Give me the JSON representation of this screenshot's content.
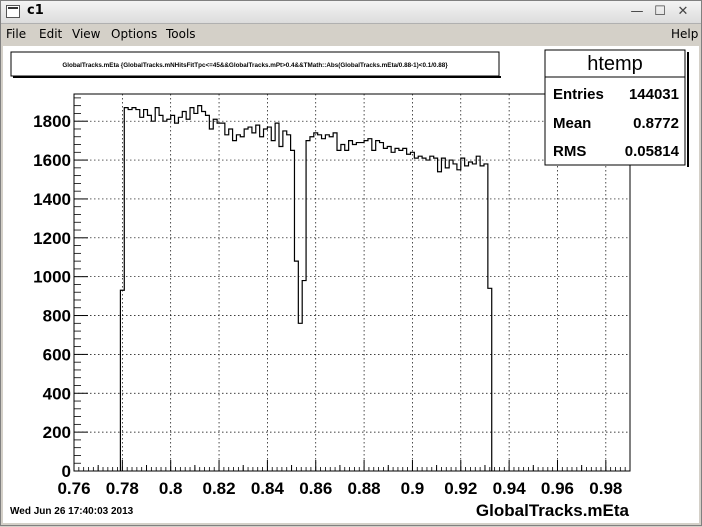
{
  "window": {
    "title": "c1"
  },
  "titlebar_buttons": {
    "minimize": "—",
    "maximize": "☐",
    "close": "✕"
  },
  "menu": {
    "file": "File",
    "edit": "Edit",
    "view": "View",
    "options": "Options",
    "tools": "Tools",
    "help": "Help"
  },
  "canvas": {
    "title_box": "GlobalTracks.mEta {GlobalTracks.mNHitsFitTpc<=45&&GlobalTracks.mPt>0.4&&TMath::Abs(GlobalTracks.mEta/0.88-1)<0.1/0.88}",
    "timestamp": "Wed Jun 26 17:40:03 2013",
    "stats": {
      "name": "htemp",
      "entries_label": "Entries",
      "entries_value": "144031",
      "mean_label": "Mean",
      "mean_value": "0.8772",
      "rms_label": "RMS",
      "rms_value": "0.05814"
    }
  },
  "chart_data": {
    "type": "histogram",
    "xlabel": "GlobalTracks.mEta",
    "xlim": [
      0.76,
      0.99
    ],
    "ylim": [
      0,
      1940
    ],
    "xticks": [
      0.76,
      0.78,
      0.8,
      0.82,
      0.84,
      0.86,
      0.88,
      0.9,
      0.92,
      0.94,
      0.96,
      0.98
    ],
    "xtick_labels": [
      "0.76",
      "0.78",
      "0.8",
      "0.82",
      "0.84",
      "0.86",
      "0.88",
      "0.9",
      "0.92",
      "0.94",
      "0.96",
      "0.98"
    ],
    "yticks": [
      0,
      200,
      400,
      600,
      800,
      1000,
      1200,
      1400,
      1600,
      1800
    ],
    "ytick_labels": [
      "0",
      "200",
      "400",
      "600",
      "800",
      "1000",
      "1200",
      "1400",
      "1600",
      "1800"
    ],
    "grid": true,
    "bin_low": 0.7792,
    "bin_width": 0.0016,
    "values": [
      930,
      1870,
      1860,
      1870,
      1860,
      1820,
      1860,
      1830,
      1800,
      1870,
      1830,
      1800,
      1810,
      1830,
      1790,
      1820,
      1850,
      1810,
      1870,
      1840,
      1880,
      1850,
      1830,
      1760,
      1810,
      1790,
      1790,
      1730,
      1760,
      1700,
      1730,
      1720,
      1760,
      1770,
      1740,
      1780,
      1720,
      1760,
      1770,
      1700,
      1790,
      1670,
      1750,
      1730,
      1650,
      1080,
      760,
      980,
      1700,
      1720,
      1740,
      1730,
      1710,
      1730,
      1720,
      1740,
      1650,
      1680,
      1650,
      1700,
      1680,
      1690,
      1690,
      1700,
      1710,
      1650,
      1700,
      1690,
      1660,
      1670,
      1640,
      1660,
      1650,
      1660,
      1630,
      1640,
      1610,
      1620,
      1610,
      1600,
      1620,
      1610,
      1540,
      1610,
      1560,
      1600,
      1580,
      1550,
      1610,
      1570,
      1590,
      1580,
      1620,
      1570,
      1580,
      940
    ]
  }
}
